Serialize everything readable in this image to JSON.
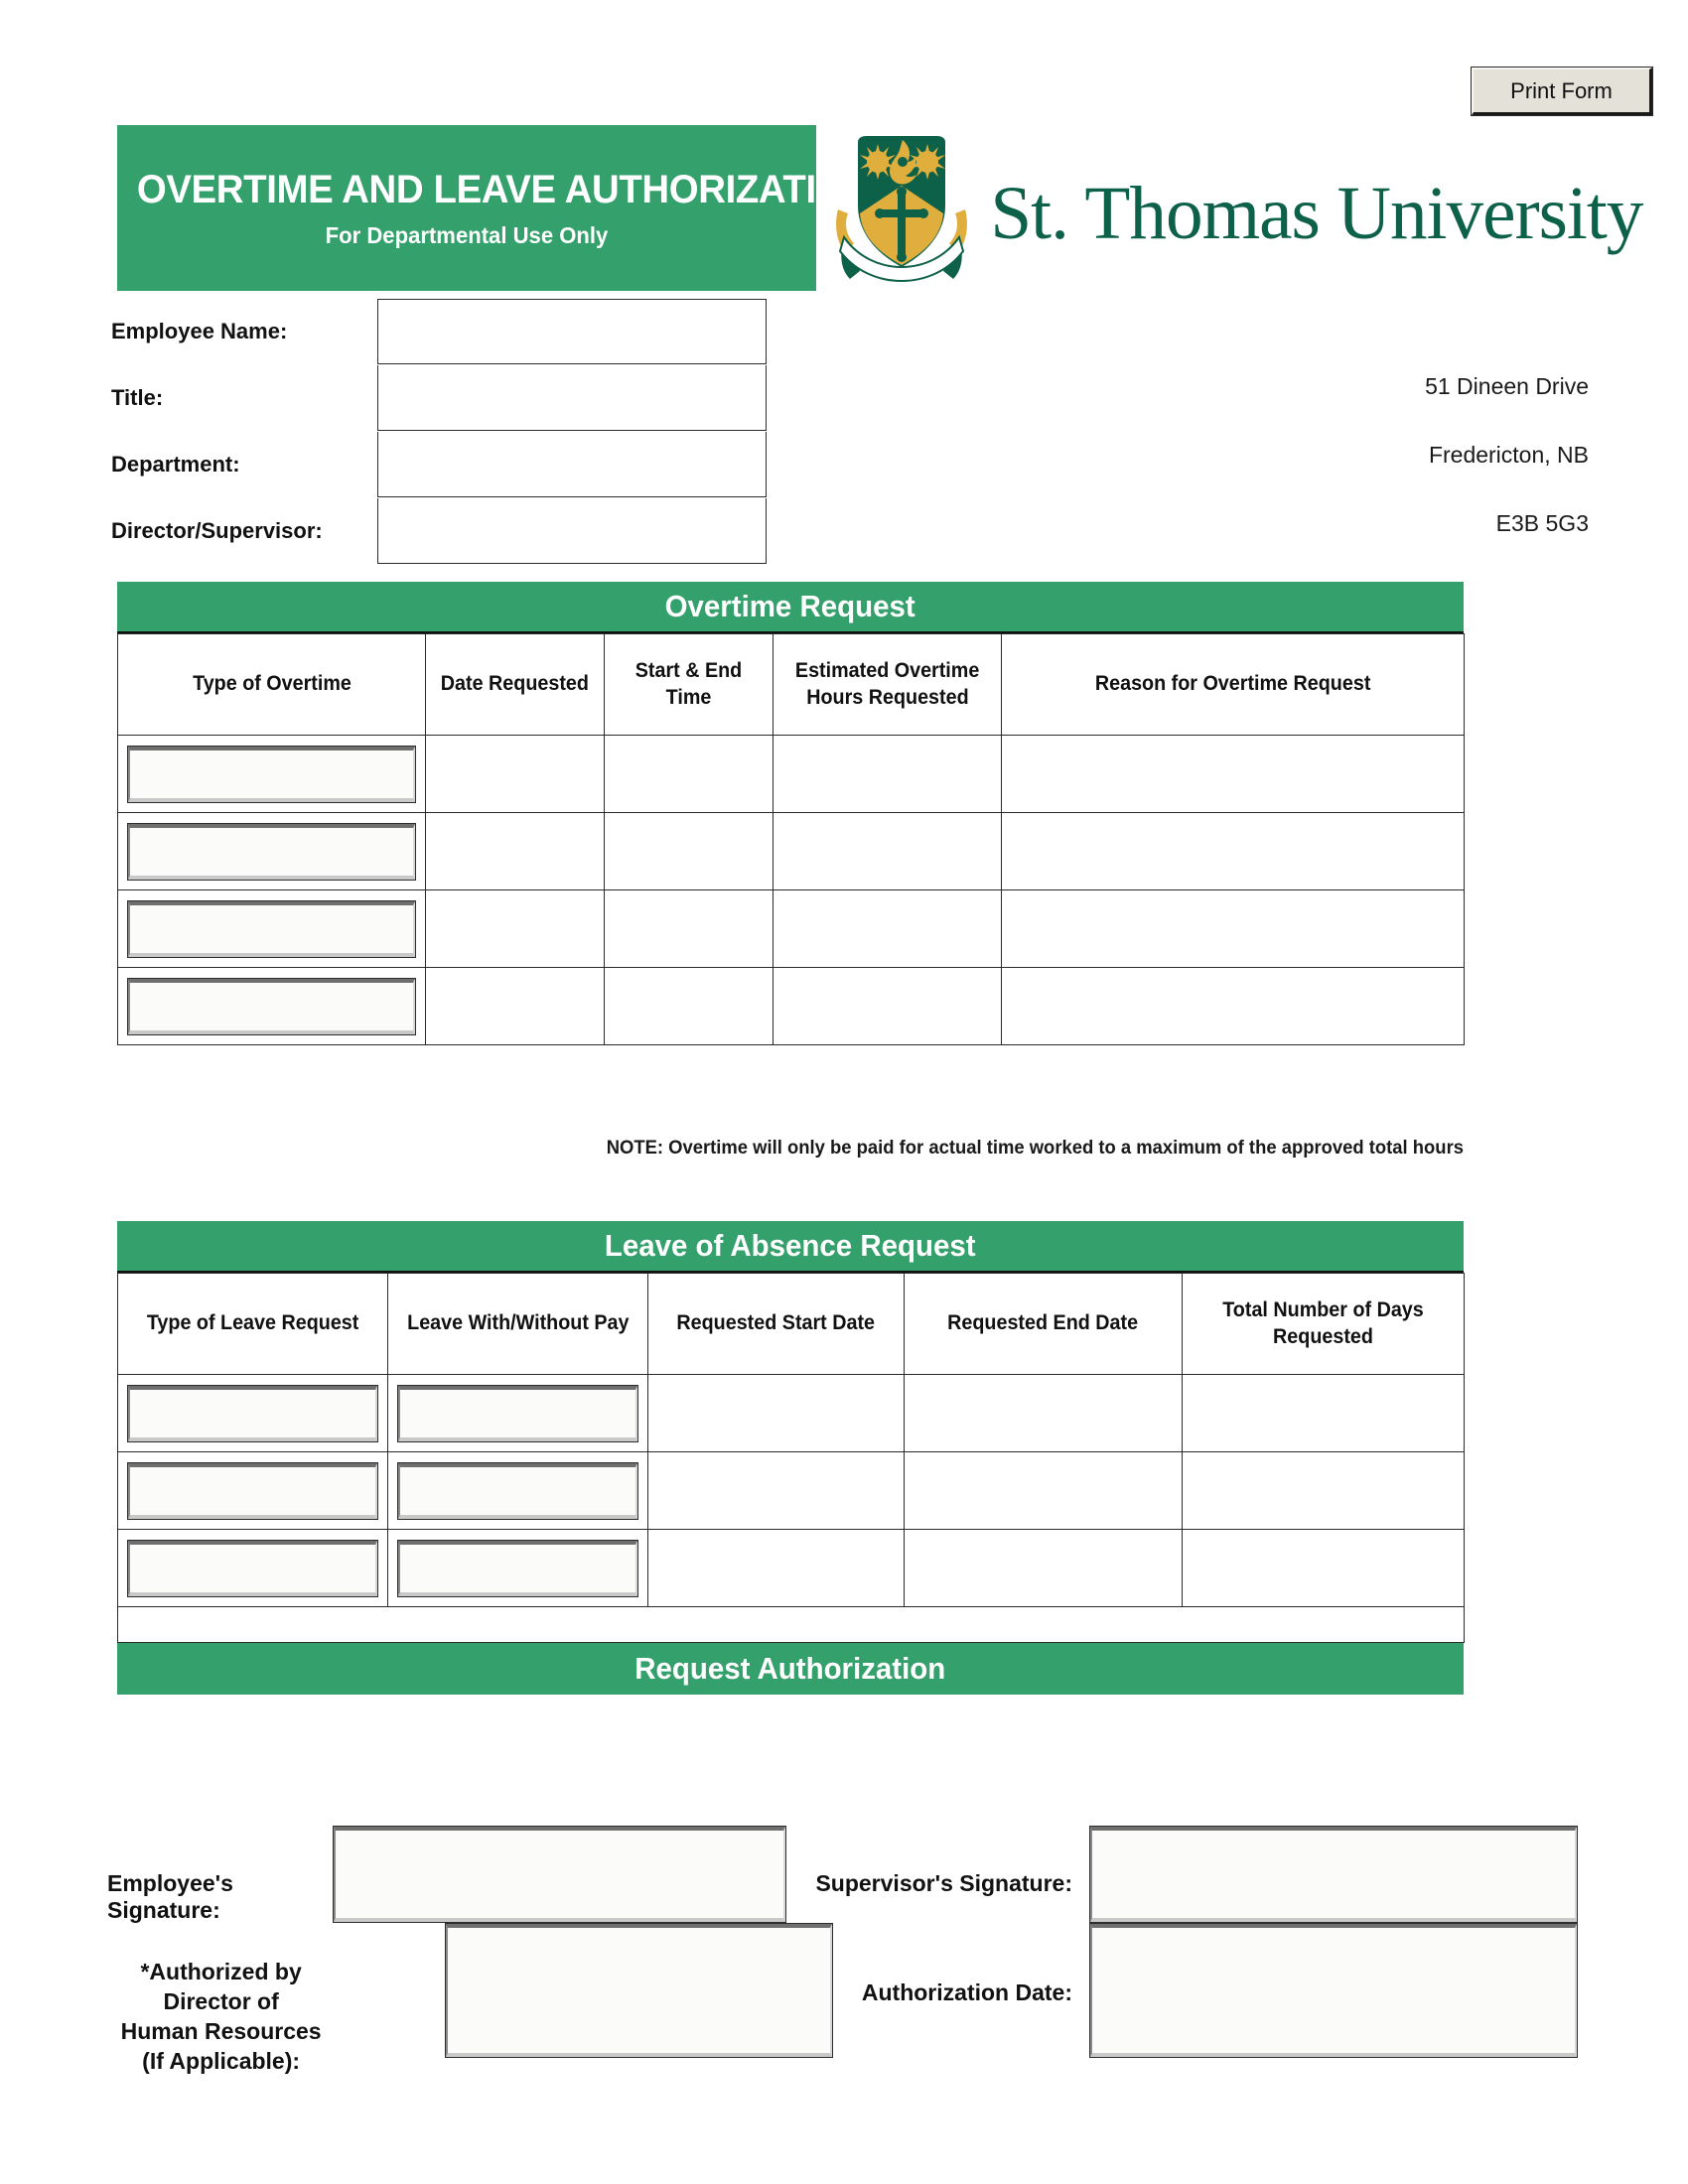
{
  "toolbar": {
    "print_form_label": "Print Form"
  },
  "header": {
    "title": "OVERTIME AND LEAVE AUTHORIZATION FORM",
    "subtitle": "For Departmental Use Only",
    "university_name": "St. Thomas University",
    "brand_green": "#34a06b",
    "logo_green": "#0d6149",
    "logo_gold": "#e0ae3c"
  },
  "employee_info": {
    "fields": [
      {
        "label": "Employee Name:",
        "value": ""
      },
      {
        "label": "Title:",
        "value": ""
      },
      {
        "label": "Department:",
        "value": ""
      },
      {
        "label": "Director/Supervisor:",
        "value": ""
      }
    ]
  },
  "address": {
    "line1": "51 Dineen Drive",
    "line2": "Fredericton, NB",
    "line3": "E3B 5G3"
  },
  "overtime": {
    "band_title": "Overtime Request",
    "columns": [
      "Type of Overtime",
      "Date Requested",
      "Start & End Time",
      "Estimated Overtime Hours Requested",
      "Reason for Overtime Request"
    ],
    "col_header_4_line1": "Estimated Overtime",
    "col_header_4_line2": "Hours Requested",
    "rows": [
      {
        "type": "",
        "date": "",
        "time": "",
        "hours": "",
        "reason": ""
      },
      {
        "type": "",
        "date": "",
        "time": "",
        "hours": "",
        "reason": ""
      },
      {
        "type": "",
        "date": "",
        "time": "",
        "hours": "",
        "reason": ""
      },
      {
        "type": "",
        "date": "",
        "time": "",
        "hours": "",
        "reason": ""
      }
    ],
    "note": "NOTE: Overtime will only be paid for actual time worked to a maximum of the approved total hours"
  },
  "leave": {
    "band_title": "Leave of Absence Request",
    "columns": [
      "Type of Leave Request",
      "Leave With/Without Pay",
      "Requested Start Date",
      "Requested End Date",
      "Total Number of Days Requested"
    ],
    "rows": [
      {
        "type": "",
        "pay": "",
        "start": "",
        "end": "",
        "days": ""
      },
      {
        "type": "",
        "pay": "",
        "start": "",
        "end": "",
        "days": ""
      },
      {
        "type": "",
        "pay": "",
        "start": "",
        "end": "",
        "days": ""
      }
    ]
  },
  "authorization": {
    "band_title": "Request Authorization",
    "employee_signature_label": "Employee's Signature:",
    "supervisor_signature_label": "Supervisor's Signature:",
    "hr_label_line1": "*Authorized by Director of",
    "hr_label_line2": "Human Resources (If Applicable):",
    "authorization_date_label": "Authorization Date:",
    "employee_signature_value": "",
    "supervisor_signature_value": "",
    "hr_signature_value": "",
    "authorization_date_value": ""
  }
}
